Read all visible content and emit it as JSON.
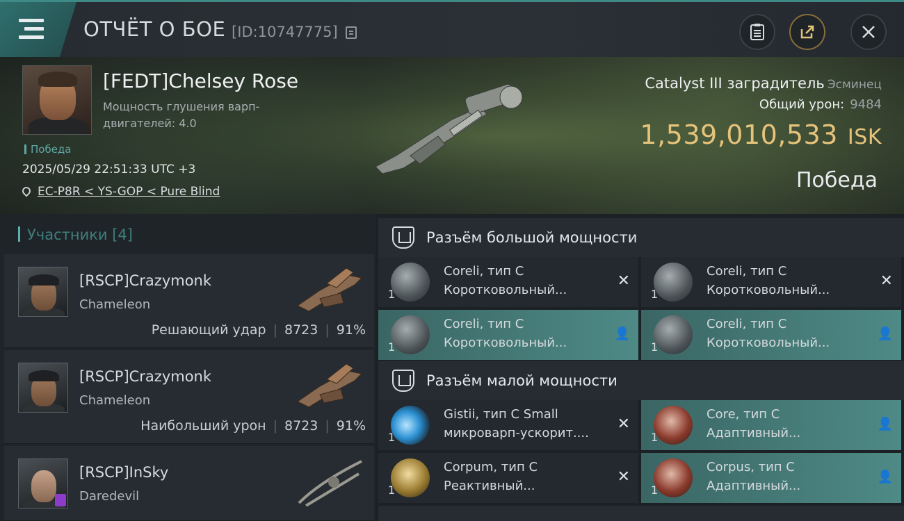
{
  "header": {
    "title": "ОТЧЁТ О БОЕ",
    "battle_id": "[ID:10747775]"
  },
  "victim": {
    "name": "[FEDT]Chelsey Rose",
    "attribute": "Мощность глушения варп-двигателей: 4.0",
    "result_tag": "Победа",
    "datetime": "2025/05/29 22:51:33 UTC +3",
    "location": "EC-P8R < YS-GOP < Pure Blind",
    "ship_name": "Catalyst III заградитель",
    "ship_class": "Эсминец",
    "damage_label": "Общий урон:",
    "damage_value": "9484",
    "isk_value": "1,539,010,533",
    "isk_unit": "ISK",
    "outcome": "Победа"
  },
  "participants": {
    "title": "Участники [4]",
    "items": [
      {
        "name": "[RSCP]Crazymonk",
        "ship": "Chameleon",
        "role": "Решающий удар",
        "damage": "8723",
        "percent": "91%"
      },
      {
        "name": "[RSCP]Crazymonk",
        "ship": "Chameleon",
        "role": "Наибольший урон",
        "damage": "8723",
        "percent": "91%"
      },
      {
        "name": "[RSCP]InSky",
        "ship": "Daredevil"
      }
    ]
  },
  "fitting": {
    "high_slots_label": "Разъём большой мощности",
    "low_slots_label": "Разъём малой мощности",
    "high": [
      {
        "qty": "1",
        "line1": "Coreli, тип C",
        "line2": "Коротковольный...",
        "state": "destroyed"
      },
      {
        "qty": "1",
        "line1": "Coreli, тип C",
        "line2": "Коротковольный...",
        "state": "destroyed"
      },
      {
        "qty": "1",
        "line1": "Coreli, тип C",
        "line2": "Коротковольный...",
        "state": "dropped"
      },
      {
        "qty": "1",
        "line1": "Coreli, тип C",
        "line2": "Коротковольный...",
        "state": "dropped"
      }
    ],
    "low": [
      {
        "qty": "1",
        "line1": "Gistii, тип C Small",
        "line2": "микроварп-ускорит....",
        "state": "destroyed"
      },
      {
        "qty": "1",
        "line1": "Core, тип C",
        "line2": "Адаптивный...",
        "state": "dropped"
      },
      {
        "qty": "1",
        "line1": "Corpum, тип C",
        "line2": "Реактивный...",
        "state": "destroyed"
      },
      {
        "qty": "1",
        "line1": "Corpus, тип C",
        "line2": "Адаптивный...",
        "state": "dropped"
      }
    ]
  },
  "icons": {
    "menu": "hamburger-icon",
    "copy": "copy-icon",
    "clipboard": "clipboard-icon",
    "share": "share-icon",
    "close": "close-icon",
    "location": "location-pin-icon",
    "destroyed": "x-icon",
    "dropped": "person-icon"
  },
  "colors": {
    "accent": "#3d8a86",
    "isk": "#e6c37a",
    "dropped_bg": "#4e8a86"
  }
}
